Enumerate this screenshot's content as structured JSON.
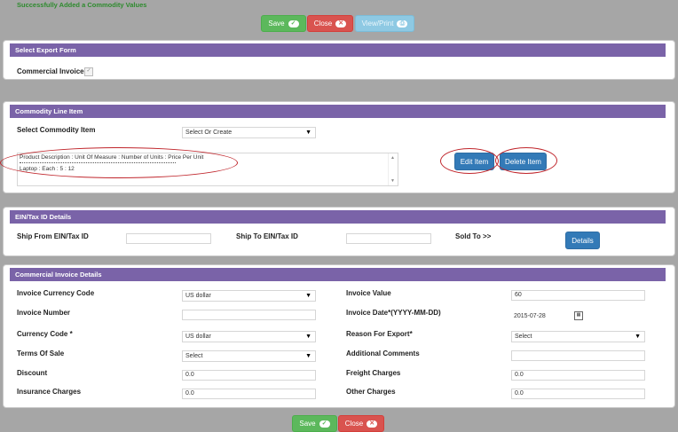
{
  "message": "Successfully Added a Commodity Values",
  "toolbar": {
    "save": "Save",
    "close": "Close",
    "view_print": "View/Print"
  },
  "export_form": {
    "title": "Select Export Form",
    "commercial_invoice_label": "Commercial Invoice",
    "checked": true
  },
  "commodity": {
    "title": "Commodity Line Item",
    "select_label": "Select Commodity Item",
    "select_value": "Select Or Create",
    "list_header": "Product Description : Unit Of Measure : Number of Units : Price Per Unit",
    "list_item": "Laptop : Each : 5 : 12",
    "edit_label": "Edit Item",
    "delete_label": "Delete Item"
  },
  "ein": {
    "title": "EIN/Tax ID Details",
    "ship_from_label": "Ship From EIN/Tax ID",
    "ship_from_value": "",
    "ship_to_label": "Ship To EIN/Tax ID",
    "ship_to_value": "",
    "sold_to_label": "Sold To >>",
    "details_label": "Details"
  },
  "invoice": {
    "title": "Commercial Invoice Details",
    "currency_code_label": "Invoice Currency Code",
    "currency_code_value": "US dollar",
    "invoice_value_label": "Invoice Value",
    "invoice_value_value": "60",
    "invoice_number_label": "Invoice Number",
    "invoice_number_value": "",
    "invoice_date_label": "Invoice Date*(YYYY-MM-DD)",
    "invoice_date_value": "2015-07-28",
    "currency_code2_label": "Currency Code *",
    "currency_code2_value": "US dollar",
    "reason_label": "Reason For Export*",
    "reason_value": "Select",
    "terms_label": "Terms Of Sale",
    "terms_value": "Select",
    "comments_label": "Additional Comments",
    "comments_value": "",
    "discount_label": "Discount",
    "discount_value": "0.0",
    "freight_label": "Freight Charges",
    "freight_value": "0.0",
    "insurance_label": "Insurance Charges",
    "insurance_value": "0.0",
    "other_label": "Other Charges",
    "other_value": "0.0"
  },
  "footer": {
    "save": "Save",
    "close": "Close"
  },
  "icons": {
    "check": "check-icon",
    "close": "x-circle-icon",
    "print": "printer-icon",
    "dropdown": "caret-down-icon",
    "calendar": "calendar-icon"
  },
  "colors": {
    "panel_header": "#7a63a8",
    "success_text": "#2e8b2e",
    "save_green": "#5cb85c",
    "close_red": "#d9534f",
    "view_cyan": "#8ec9e3",
    "primary_blue": "#337ab7",
    "annotation_red": "#c0262c"
  }
}
